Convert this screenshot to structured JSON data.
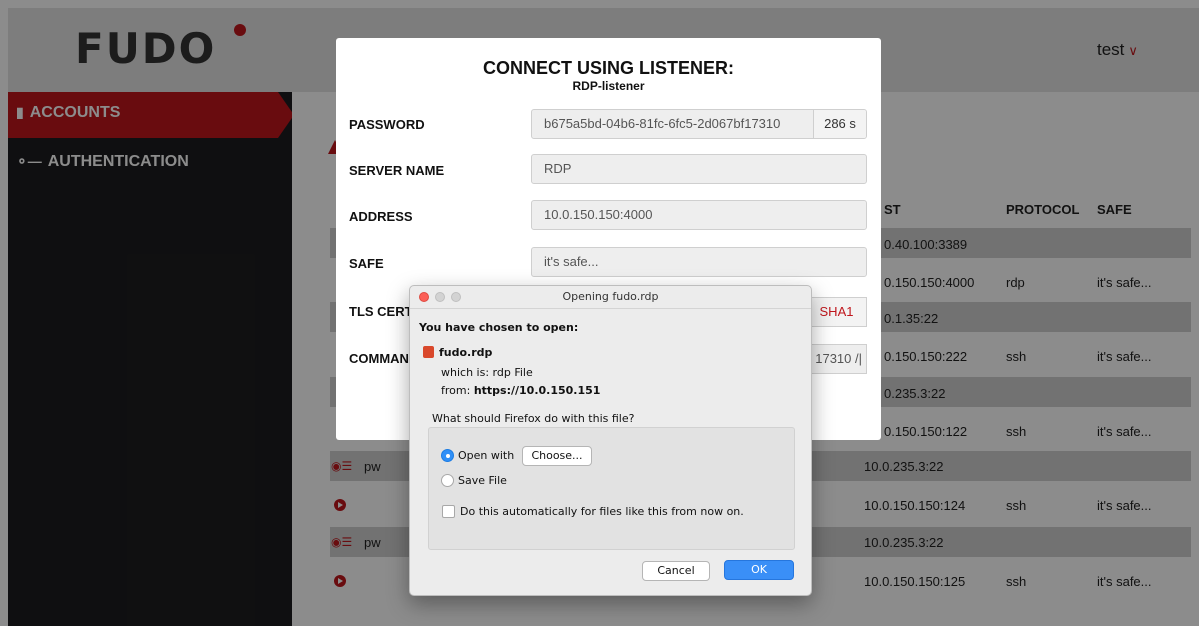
{
  "app": {
    "logo_text": "FUDO",
    "user": "test",
    "colors": {
      "accent": "#c0171d",
      "sidebar": "#1d1d1f",
      "primary_button": "#3a8ff7"
    }
  },
  "sidebar": {
    "items": [
      {
        "label": "ACCOUNTS",
        "icon": "book-icon",
        "active": true
      },
      {
        "label": "AUTHENTICATION",
        "icon": "key-icon",
        "active": false
      }
    ]
  },
  "table": {
    "headers": {
      "host": "ST",
      "protocol": "PROTOCOL",
      "safe": "SAFE"
    },
    "rows": [
      {
        "host": "0.40.100:3389",
        "protocol": "",
        "safe": ""
      },
      {
        "host": "0.150.150:4000",
        "protocol": "rdp",
        "safe": "it's safe..."
      },
      {
        "host": "0.1.35:22",
        "protocol": "",
        "safe": ""
      },
      {
        "host": "0.150.150:222",
        "protocol": "ssh",
        "safe": "it's safe..."
      },
      {
        "host": "0.235.3:22",
        "protocol": "",
        "safe": ""
      },
      {
        "host": "0.150.150:122",
        "protocol": "ssh",
        "safe": "it's safe..."
      },
      {
        "host": "10.0.235.3:22",
        "protocol": "",
        "safe": "",
        "name": "pw"
      },
      {
        "host": "10.0.150.150:124",
        "protocol": "ssh",
        "safe": "it's safe..."
      },
      {
        "host": "10.0.235.3:22",
        "protocol": "",
        "safe": "",
        "name": "pw"
      },
      {
        "host": "10.0.150.150:125",
        "protocol": "ssh",
        "safe": "it's safe..."
      }
    ]
  },
  "modal": {
    "title": "CONNECT USING LISTENER:",
    "subtitle": "RDP-listener",
    "fields": {
      "password": {
        "label": "PASSWORD",
        "value": "b675a5bd-04b6-81fc-6fc5-2d067bf17310",
        "suffix": "286 s"
      },
      "server_name": {
        "label": "SERVER NAME",
        "value": "RDP"
      },
      "address": {
        "label": "ADDRESS",
        "value": "10.0.150.150:4000"
      },
      "safe": {
        "label": "SAFE",
        "value": "it's safe..."
      },
      "tls": {
        "label": "TLS CERTI",
        "suffix": "SHA1"
      },
      "command": {
        "label": "COMMANI",
        "value_tail": "17310 /|"
      }
    }
  },
  "dialog": {
    "title": "Opening fudo.rdp",
    "chosen_text": "You have chosen to open:",
    "file_name": "fudo.rdp",
    "which_is": "which is: rdp File",
    "from_label": "from:",
    "from_url": "https://10.0.150.151",
    "question": "What should Firefox do with this file?",
    "open_with_label": "Open with",
    "choose_label": "Choose...",
    "save_file_label": "Save File",
    "auto_label": "Do this automatically for files like this from now on.",
    "cancel_label": "Cancel",
    "ok_label": "OK"
  }
}
